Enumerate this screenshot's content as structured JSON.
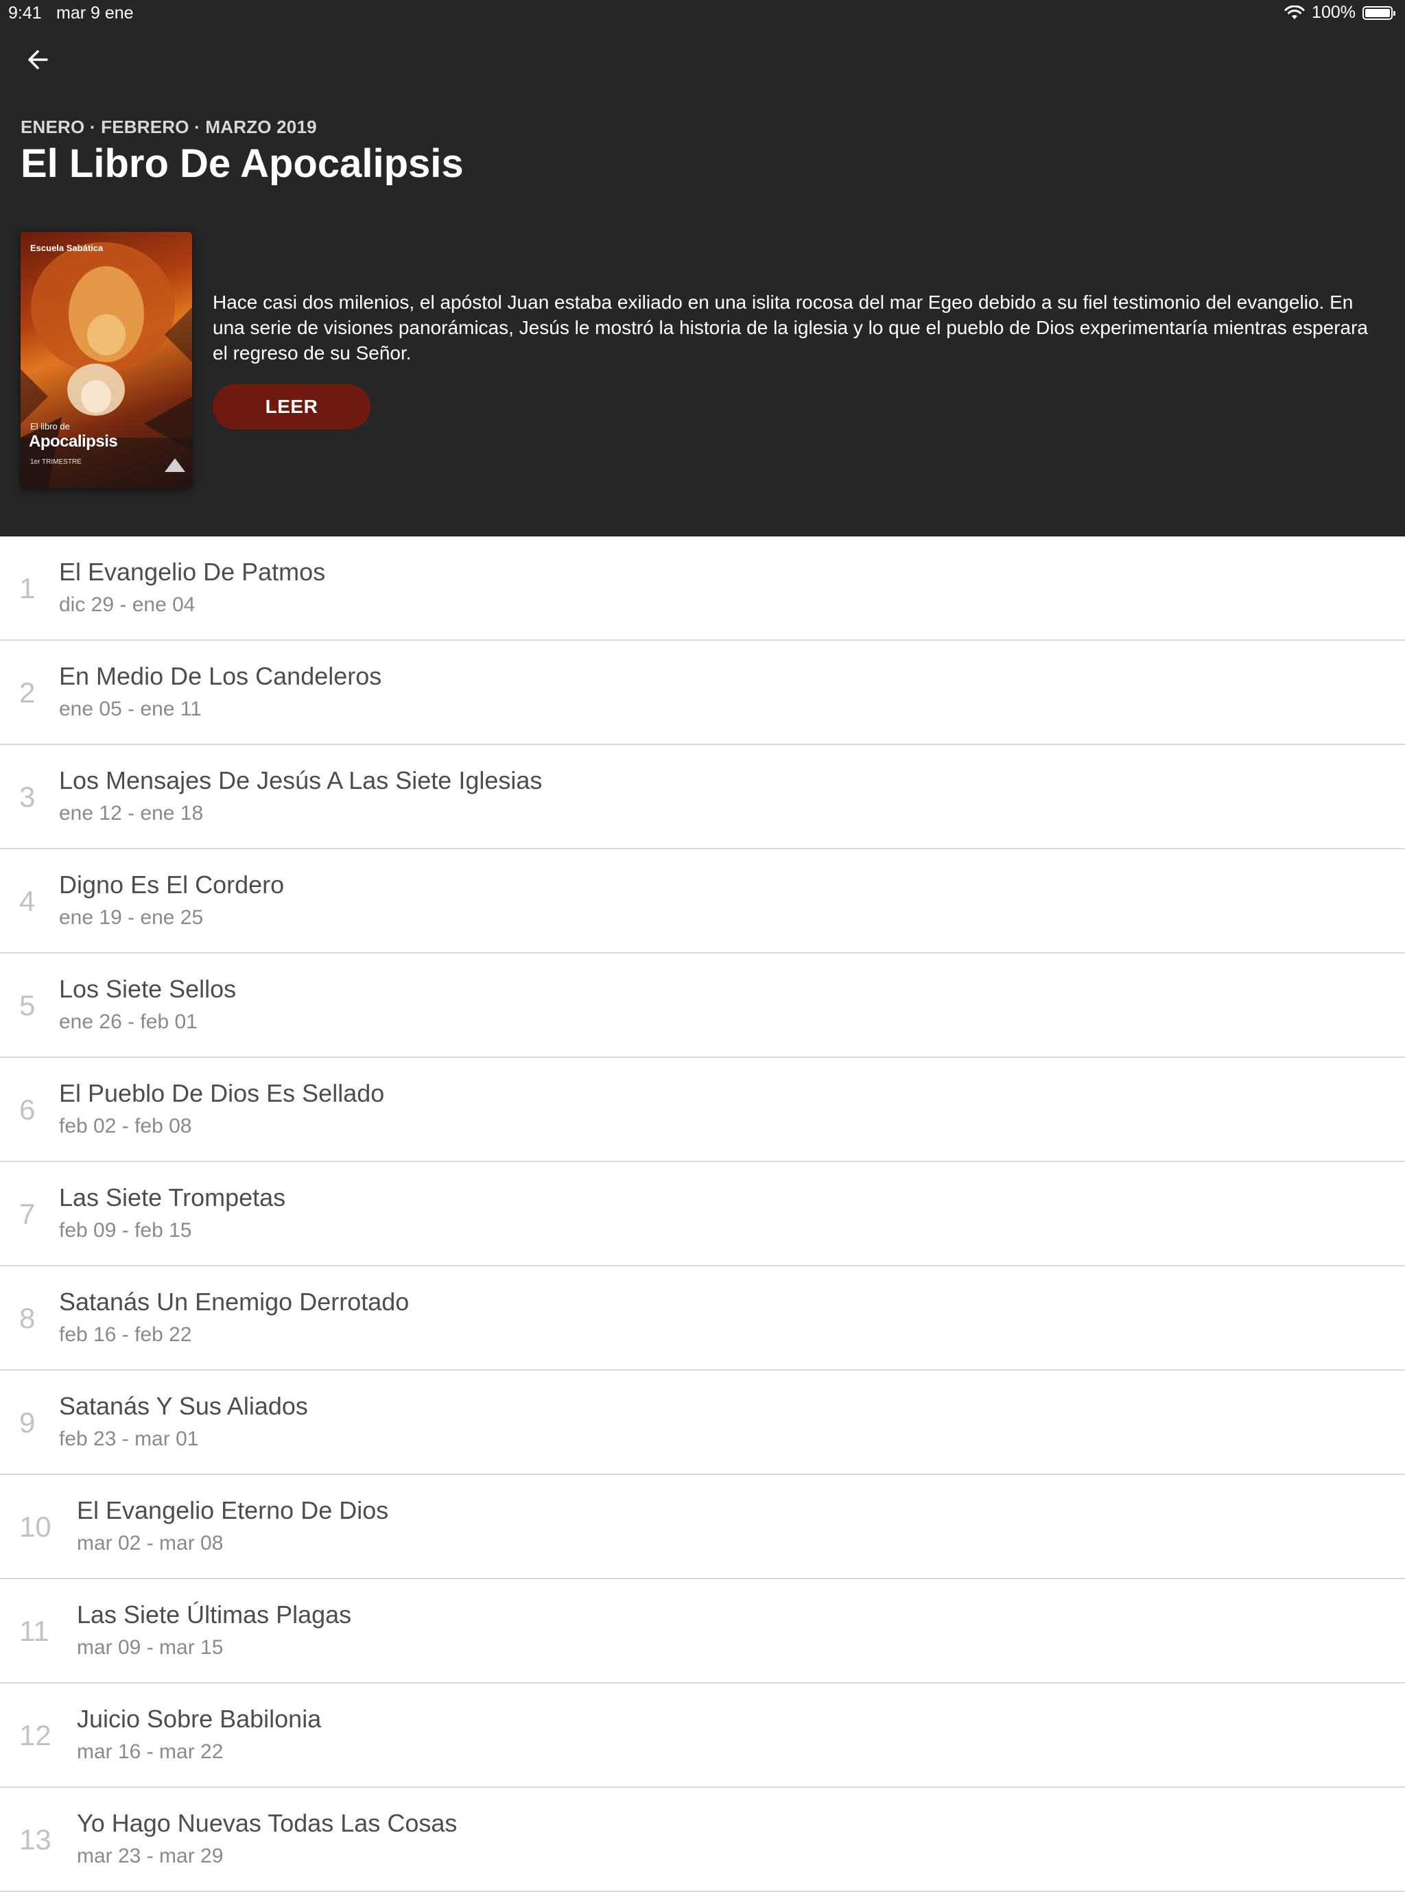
{
  "status_bar": {
    "time": "9:41",
    "date": "mar 9 ene",
    "battery": "100%"
  },
  "header": {
    "quarter_label": "ENERO · FEBRERO · MARZO 2019",
    "title": "El Libro De Apocalipsis",
    "description": "Hace casi dos milenios, el apóstol Juan estaba exiliado en una islita rocosa del mar Egeo debido a su fiel testimonio del evangelio. En una serie de visiones panorámicas, Jesús le mostró la historia de la iglesia y lo que el pueblo de Dios experimentaría mientras esperara el regreso de su Señor.",
    "read_button": "LEER",
    "cover": {
      "publisher": "Escuela Sabática",
      "subtitle": "El libro de",
      "title": "Apocalipsis",
      "trimester": "1er TRIMESTRE"
    }
  },
  "colors": {
    "header_bg": "#262626",
    "read_button_bg": "#6e1a0e",
    "divider": "#d9d9d9"
  },
  "lessons": [
    {
      "number": "1",
      "title": "El Evangelio De Patmos",
      "dates": "dic 29 - ene 04"
    },
    {
      "number": "2",
      "title": "En Medio De Los Candeleros",
      "dates": "ene 05 - ene 11"
    },
    {
      "number": "3",
      "title": "Los Mensajes De Jesús A Las Siete Iglesias",
      "dates": "ene 12 - ene 18"
    },
    {
      "number": "4",
      "title": "Digno Es El Cordero",
      "dates": "ene 19 - ene 25"
    },
    {
      "number": "5",
      "title": "Los Siete Sellos",
      "dates": "ene 26 - feb 01"
    },
    {
      "number": "6",
      "title": "El Pueblo De Dios Es Sellado",
      "dates": "feb 02 - feb 08"
    },
    {
      "number": "7",
      "title": "Las Siete Trompetas",
      "dates": "feb 09 - feb 15"
    },
    {
      "number": "8",
      "title": "Satanás Un Enemigo Derrotado",
      "dates": "feb 16 - feb 22"
    },
    {
      "number": "9",
      "title": "Satanás Y Sus Aliados",
      "dates": "feb 23 - mar 01"
    },
    {
      "number": "10",
      "title": "El Evangelio Eterno De Dios",
      "dates": "mar 02 - mar 08"
    },
    {
      "number": "11",
      "title": "Las Siete Últimas Plagas",
      "dates": "mar 09 - mar 15"
    },
    {
      "number": "12",
      "title": "Juicio Sobre Babilonia",
      "dates": "mar 16 - mar 22"
    },
    {
      "number": "13",
      "title": "Yo Hago Nuevas Todas Las Cosas",
      "dates": "mar 23 - mar 29"
    }
  ]
}
